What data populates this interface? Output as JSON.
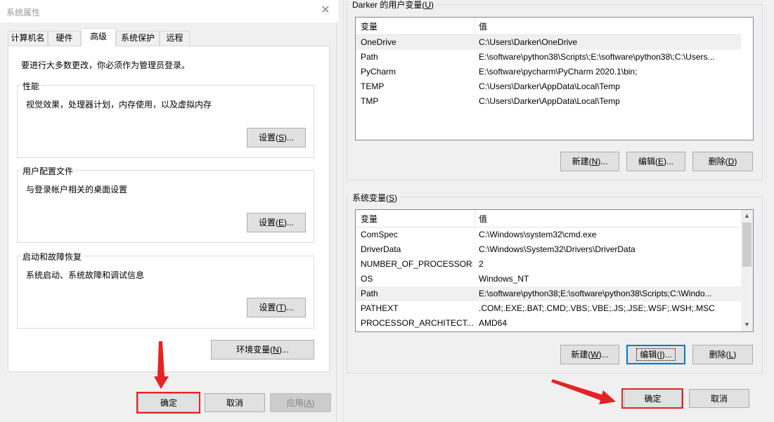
{
  "left_dialog": {
    "title": "系统属性",
    "close_glyph": "✕",
    "tabs": [
      {
        "label": "计算机名"
      },
      {
        "label": "硬件"
      },
      {
        "label": "高级"
      },
      {
        "label": "系统保护"
      },
      {
        "label": "远程"
      }
    ],
    "admin_note": "要进行大多数更改，你必须作为管理员登录。",
    "groups": {
      "performance": {
        "title": "性能",
        "desc": "视觉效果，处理器计划，内存使用，以及虚拟内存",
        "button_pre": "设置(",
        "button_key": "S",
        "button_post": ")..."
      },
      "profile": {
        "title": "用户配置文件",
        "desc": "与登录帐户相关的桌面设置",
        "button_pre": "设置(",
        "button_key": "E",
        "button_post": ")..."
      },
      "startup": {
        "title": "启动和故障恢复",
        "desc": "系统启动、系统故障和调试信息",
        "button_pre": "设置(",
        "button_key": "T",
        "button_post": ")..."
      }
    },
    "env_button": {
      "pre": "环境变量(",
      "key": "N",
      "post": ")..."
    },
    "footer": {
      "ok": "确定",
      "cancel": "取消",
      "apply_pre": "应用(",
      "apply_key": "A",
      "apply_post": ")"
    }
  },
  "right_dialog": {
    "user_vars": {
      "title_pre": "Darker 的用户变量(",
      "title_key": "U",
      "title_post": ")",
      "col_var": "变量",
      "col_val": "值",
      "rows": [
        {
          "name": "OneDrive",
          "value": "C:\\Users\\Darker\\OneDrive"
        },
        {
          "name": "Path",
          "value": "E:\\software\\python38\\Scripts\\;E:\\software\\python38\\;C:\\Users..."
        },
        {
          "name": "PyCharm",
          "value": "E:\\software\\pycharm\\PyCharm 2020.1\\bin;"
        },
        {
          "name": "TEMP",
          "value": "C:\\Users\\Darker\\AppData\\Local\\Temp"
        },
        {
          "name": "TMP",
          "value": "C:\\Users\\Darker\\AppData\\Local\\Temp"
        }
      ],
      "buttons": {
        "new": {
          "pre": "新建(",
          "key": "N",
          "post": ")..."
        },
        "edit": {
          "pre": "编辑(",
          "key": "E",
          "post": ")..."
        },
        "delete": {
          "pre": "删除(",
          "key": "D",
          "post": ")"
        }
      }
    },
    "system_vars": {
      "title_pre": "系统变量(",
      "title_key": "S",
      "title_post": ")",
      "col_var": "变量",
      "col_val": "值",
      "rows": [
        {
          "name": "ComSpec",
          "value": "C:\\Windows\\system32\\cmd.exe"
        },
        {
          "name": "DriverData",
          "value": "C:\\Windows\\System32\\Drivers\\DriverData"
        },
        {
          "name": "NUMBER_OF_PROCESSORS",
          "value": "2"
        },
        {
          "name": "OS",
          "value": "Windows_NT"
        },
        {
          "name": "Path",
          "value": "E:\\software\\python38;E:\\software\\python38\\Scripts;C:\\Windo..."
        },
        {
          "name": "PATHEXT",
          "value": ".COM;.EXE;.BAT;.CMD;.VBS;.VBE;.JS;.JSE;.WSF;.WSH;.MSC"
        },
        {
          "name": "PROCESSOR_ARCHITECT...",
          "value": "AMD64"
        }
      ],
      "buttons": {
        "new": {
          "pre": "新建(",
          "key": "W",
          "post": ")..."
        },
        "edit": {
          "pre": "编辑(",
          "key": "I",
          "post": ")..."
        },
        "delete": {
          "pre": "删除(",
          "key": "L",
          "post": ")"
        }
      }
    },
    "footer": {
      "ok": "确定",
      "cancel": "取消"
    }
  },
  "icons": {
    "scroll_up": "▲",
    "scroll_down": "▼"
  },
  "colors": {
    "annotation_red": "#e52323",
    "focus_blue": "#0078d7"
  }
}
